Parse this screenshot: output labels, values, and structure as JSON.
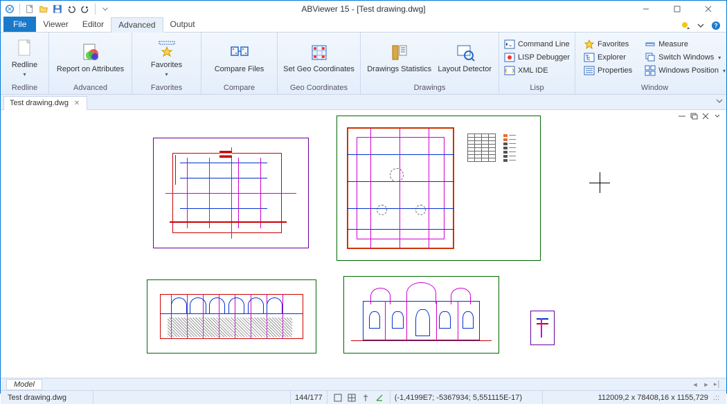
{
  "app": {
    "title": "ABViewer 15 - [Test drawing.dwg]"
  },
  "tabs": {
    "file": "File",
    "items": [
      "Viewer",
      "Editor",
      "Advanced",
      "Output"
    ],
    "active": "Advanced"
  },
  "ribbon": {
    "groups": [
      {
        "label": "Redline",
        "big": [
          {
            "label": "Redline",
            "dropdown": true
          }
        ]
      },
      {
        "label": "Advanced",
        "big": [
          {
            "label": "Report on Attributes"
          }
        ]
      },
      {
        "label": "Favorites",
        "big": [
          {
            "label": "Favorites",
            "dropdown": true
          }
        ]
      },
      {
        "label": "Compare",
        "big": [
          {
            "label": "Compare Files"
          }
        ]
      },
      {
        "label": "Geo Coordinates",
        "big": [
          {
            "label": "Set Geo Coordinates"
          }
        ]
      },
      {
        "label": "Drawings",
        "big": [
          {
            "label": "Drawings Statistics"
          },
          {
            "label": "Layout Detector"
          }
        ]
      },
      {
        "label": "Lisp",
        "small": [
          {
            "label": "Command Line"
          },
          {
            "label": "LISP Debugger"
          },
          {
            "label": "XML IDE"
          }
        ]
      },
      {
        "label": "Window",
        "small_cols": [
          [
            {
              "label": "Favorites"
            },
            {
              "label": "Explorer"
            },
            {
              "label": "Properties"
            }
          ],
          [
            {
              "label": "Measure"
            },
            {
              "label": "Switch Windows",
              "dropdown": true
            },
            {
              "label": "Windows Position",
              "dropdown": true
            }
          ]
        ]
      }
    ]
  },
  "document_tab": "Test drawing.dwg",
  "layout_tab": "Model",
  "status": {
    "file": "Test drawing.dwg",
    "page": "144/177",
    "cursor_coords": "(-1,4199E7; -5367934; 5,551115E-17)",
    "dimensions": "112009,2 x 78408,16 x 1155,729"
  }
}
